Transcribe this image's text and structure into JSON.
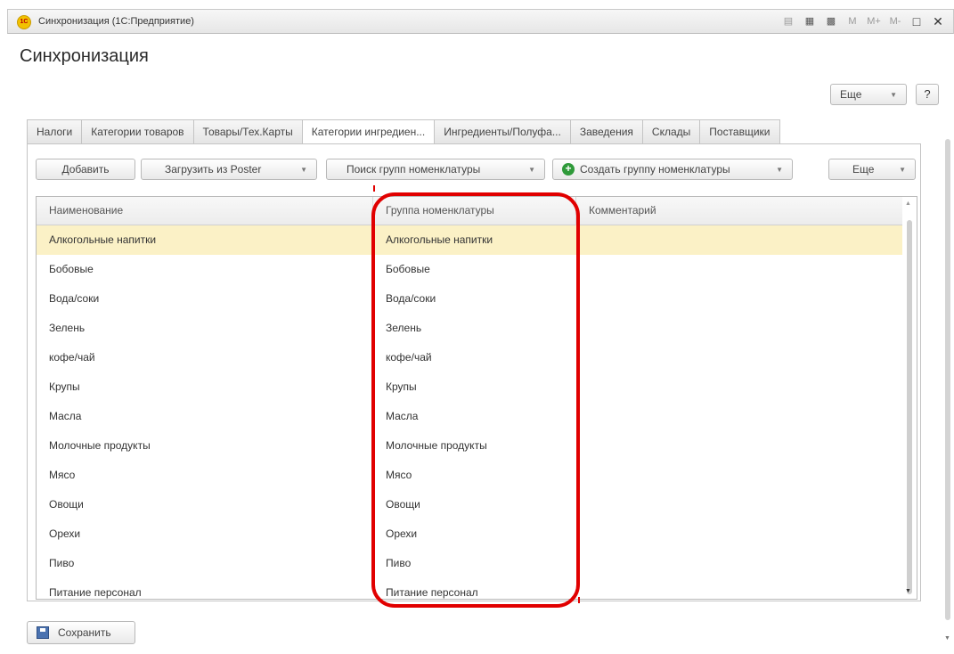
{
  "window": {
    "title": "Синхронизация (1С:Предприятие)",
    "logo": "1С"
  },
  "titlebar_icons": [
    "document-icon",
    "calculator-icon",
    "calendar-icon"
  ],
  "titlebar_labels": {
    "m": "M",
    "mplus": "M+",
    "mminus": "M-",
    "restore": "□",
    "close": "✕"
  },
  "page": {
    "title": "Синхронизация"
  },
  "top_more": {
    "label": "Еще",
    "help": "?"
  },
  "tabs": [
    {
      "label": "Налоги"
    },
    {
      "label": "Категории товаров"
    },
    {
      "label": "Товары/Тех.Карты"
    },
    {
      "label": "Категории ингредиен..."
    },
    {
      "label": "Ингредиенты/Полуфа..."
    },
    {
      "label": "Заведения"
    },
    {
      "label": "Склады"
    },
    {
      "label": "Поставщики"
    }
  ],
  "active_tab_index": 3,
  "toolbar": {
    "add": "Добавить",
    "load_from_poster": "Загрузить из Poster",
    "search_groups": "Поиск групп номенклатуры",
    "create_group": "Создать группу номенклатуры",
    "more": "Еще"
  },
  "table": {
    "columns": [
      "Наименование",
      "Группа номенклатуры",
      "Комментарий"
    ],
    "rows": [
      [
        "Алкогольные напитки",
        "Алкогольные напитки",
        ""
      ],
      [
        "Бобовые",
        "Бобовые",
        ""
      ],
      [
        "Вода/соки",
        "Вода/соки",
        ""
      ],
      [
        "Зелень",
        "Зелень",
        ""
      ],
      [
        "кофе/чай",
        "кофе/чай",
        ""
      ],
      [
        "Крупы",
        "Крупы",
        ""
      ],
      [
        "Масла",
        "Масла",
        ""
      ],
      [
        "Молочные продукты",
        "Молочные продукты",
        ""
      ],
      [
        "Мясо",
        "Мясо",
        ""
      ],
      [
        "Овощи",
        "Овощи",
        ""
      ],
      [
        "Орехи",
        "Орехи",
        ""
      ],
      [
        "Пиво",
        "Пиво",
        ""
      ],
      [
        "Питание персонал",
        "Питание персонал",
        ""
      ]
    ],
    "selected_row": 0
  },
  "footer": {
    "save": "Сохранить"
  },
  "colors": {
    "highlight": "#e10000",
    "selected_row": "#fbf1c6"
  }
}
